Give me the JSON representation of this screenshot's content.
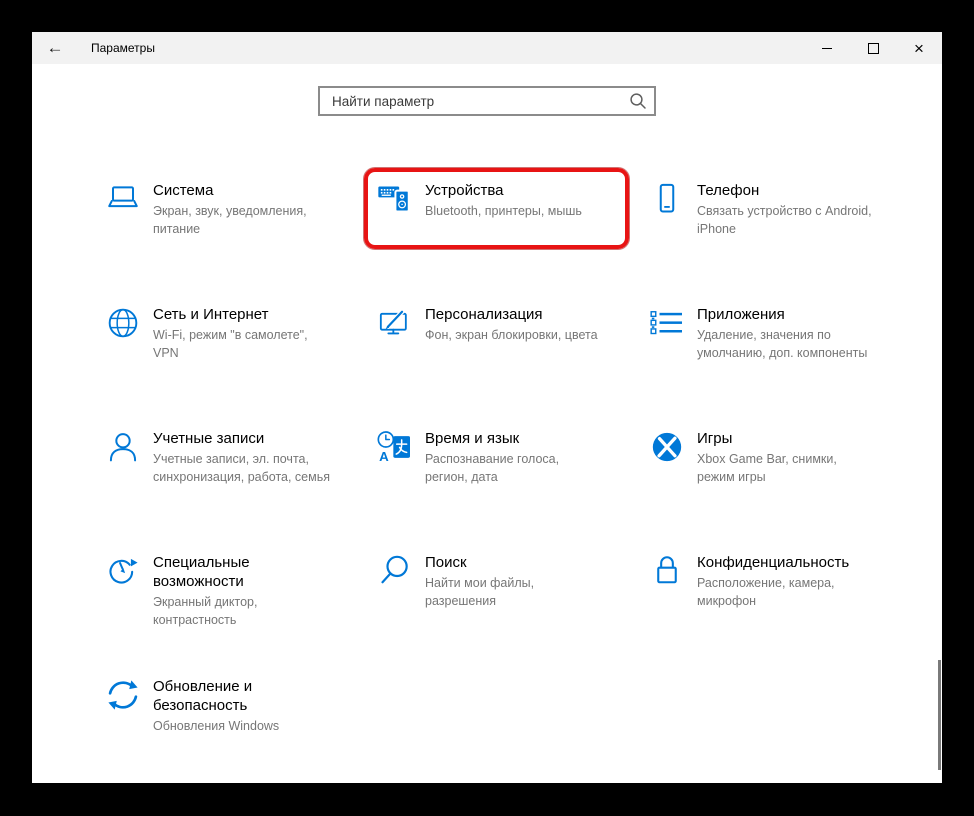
{
  "window": {
    "title": "Параметры",
    "back_glyph": "←",
    "controls": {
      "close_glyph": "×"
    }
  },
  "search": {
    "placeholder": "Найти параметр"
  },
  "colors": {
    "accent_blue": "#0078d7",
    "highlight_red": "#e81414",
    "titlebar_bg": "#f2f2f2",
    "subtitle_text": "#767676",
    "desktop_bg": "#000000"
  },
  "tiles": [
    {
      "title": "Система",
      "subtitle": "Экран, звук, уведомления,\nпитание",
      "icon": "laptop-icon",
      "highlighted": false
    },
    {
      "title": "Устройства",
      "subtitle": "Bluetooth, принтеры, мышь",
      "icon": "devices-icon",
      "highlighted": true
    },
    {
      "title": "Телефон",
      "subtitle": "Связать устройство с Android,\niPhone",
      "icon": "phone-icon",
      "highlighted": false
    },
    {
      "title": "Сеть и Интернет",
      "subtitle": "Wi-Fi, режим \"в самолете\",\nVPN",
      "icon": "globe-icon",
      "highlighted": false
    },
    {
      "title": "Персонализация",
      "subtitle": "Фон, экран блокировки, цвета",
      "icon": "personalization-icon",
      "highlighted": false
    },
    {
      "title": "Приложения",
      "subtitle": "Удаление, значения по\nумолчанию, доп. компоненты",
      "icon": "apps-icon",
      "highlighted": false
    },
    {
      "title": "Учетные записи",
      "subtitle": "Учетные записи, эл. почта,\nсинхронизация, работа, семья",
      "icon": "accounts-icon",
      "highlighted": false
    },
    {
      "title": "Время и язык",
      "subtitle": "Распознавание голоса,\nрегион, дата",
      "icon": "time-language-icon",
      "highlighted": false
    },
    {
      "title": "Игры",
      "subtitle": "Xbox Game Bar, снимки,\nрежим игры",
      "icon": "games-icon",
      "highlighted": false
    },
    {
      "title": "Специальные\nвозможности",
      "subtitle": "Экранный диктор,\nконтрастность",
      "icon": "accessibility-icon",
      "highlighted": false
    },
    {
      "title": "Поиск",
      "subtitle": "Найти мои файлы,\nразрешения",
      "icon": "search-category-icon",
      "highlighted": false
    },
    {
      "title": "Конфиденциальность",
      "subtitle": "Расположение, камера,\nмикрофон",
      "icon": "privacy-icon",
      "highlighted": false
    },
    {
      "title": "Обновление и\nбезопасность",
      "subtitle": "Обновления Windows",
      "icon": "update-icon",
      "highlighted": false
    }
  ]
}
